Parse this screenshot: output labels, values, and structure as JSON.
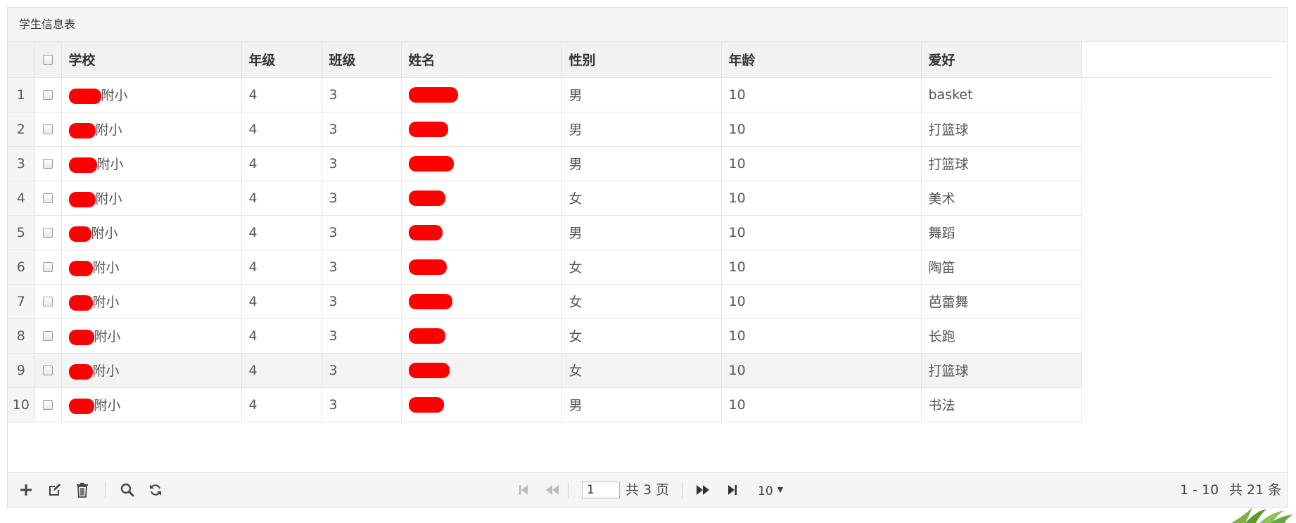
{
  "caption": "学生信息表",
  "columns": [
    "",
    "",
    "学校",
    "年级",
    "班级",
    "姓名",
    "性别",
    "年龄",
    "爱好"
  ],
  "rows": [
    {
      "num": "1",
      "school": "附小",
      "grade": "4",
      "class": "3",
      "gender": "男",
      "age": "10",
      "hobby": "basket"
    },
    {
      "num": "2",
      "school": "附小",
      "grade": "4",
      "class": "3",
      "gender": "男",
      "age": "10",
      "hobby": "打篮球"
    },
    {
      "num": "3",
      "school": "附小",
      "grade": "4",
      "class": "3",
      "gender": "男",
      "age": "10",
      "hobby": "打篮球"
    },
    {
      "num": "4",
      "school": "附小",
      "grade": "4",
      "class": "3",
      "gender": "女",
      "age": "10",
      "hobby": "美术"
    },
    {
      "num": "5",
      "school": "附小",
      "grade": "4",
      "class": "3",
      "gender": "男",
      "age": "10",
      "hobby": "舞蹈"
    },
    {
      "num": "6",
      "school": "附小",
      "grade": "4",
      "class": "3",
      "gender": "女",
      "age": "10",
      "hobby": "陶笛"
    },
    {
      "num": "7",
      "school": "附小",
      "grade": "4",
      "class": "3",
      "gender": "女",
      "age": "10",
      "hobby": "芭蕾舞"
    },
    {
      "num": "8",
      "school": "附小",
      "grade": "4",
      "class": "3",
      "gender": "女",
      "age": "10",
      "hobby": "长跑"
    },
    {
      "num": "9",
      "school": "附小",
      "grade": "4",
      "class": "3",
      "gender": "女",
      "age": "10",
      "hobby": "打篮球"
    },
    {
      "num": "10",
      "school": "附小",
      "grade": "4",
      "class": "3",
      "gender": "男",
      "age": "10",
      "hobby": "书法"
    }
  ],
  "pager": {
    "page": "1",
    "total_pages": "共 3 页",
    "page_size": "10",
    "range": "1 - 10",
    "total": "共 21 条"
  },
  "colors": {
    "redaction": "#ff0000",
    "header_bg": "#f2f2f2",
    "hover_row": "#f3f3f3"
  },
  "icons": {
    "toolbar": [
      "add-icon",
      "edit-icon",
      "delete-icon",
      "search-icon",
      "refresh-icon"
    ],
    "paging": [
      "first-page-icon",
      "prev-page-icon",
      "next-page-icon",
      "last-page-icon"
    ]
  }
}
